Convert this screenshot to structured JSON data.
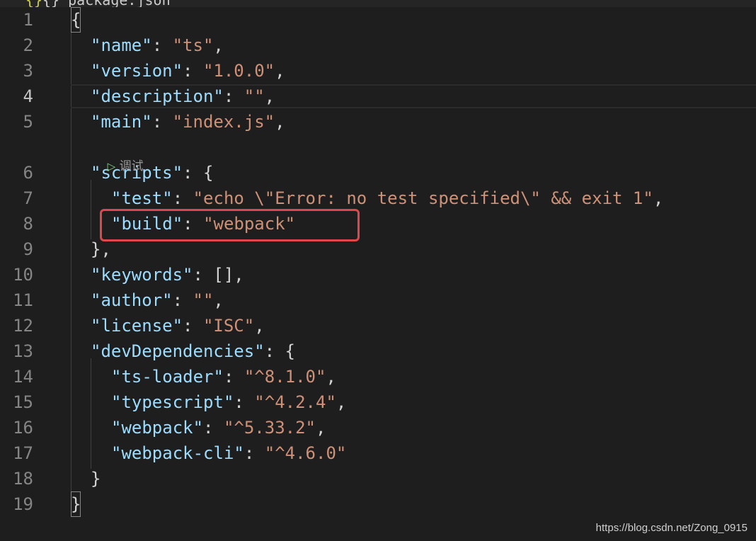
{
  "tab": {
    "icon": "json-braces-icon",
    "label": "{} package.json"
  },
  "codelens": {
    "label": "调试"
  },
  "lines": [
    {
      "n": "1",
      "tokens": [
        {
          "t": "{",
          "c": "p"
        }
      ]
    },
    {
      "n": "2",
      "tokens": [
        {
          "t": "\"name\"",
          "c": "k"
        },
        {
          "t": ": ",
          "c": "p"
        },
        {
          "t": "\"ts\"",
          "c": "s"
        },
        {
          "t": ",",
          "c": "p"
        }
      ]
    },
    {
      "n": "3",
      "tokens": [
        {
          "t": "\"version\"",
          "c": "k"
        },
        {
          "t": ": ",
          "c": "p"
        },
        {
          "t": "\"1.0.0\"",
          "c": "s"
        },
        {
          "t": ",",
          "c": "p"
        }
      ]
    },
    {
      "n": "4",
      "tokens": [
        {
          "t": "\"description\"",
          "c": "k"
        },
        {
          "t": ": ",
          "c": "p"
        },
        {
          "t": "\"\"",
          "c": "s"
        },
        {
          "t": ",",
          "c": "p"
        }
      ]
    },
    {
      "n": "5",
      "tokens": [
        {
          "t": "\"main\"",
          "c": "k"
        },
        {
          "t": ": ",
          "c": "p"
        },
        {
          "t": "\"index.js\"",
          "c": "s"
        },
        {
          "t": ",",
          "c": "p"
        }
      ]
    },
    {
      "n": "6",
      "tokens": [
        {
          "t": "\"scripts\"",
          "c": "k"
        },
        {
          "t": ": {",
          "c": "p"
        }
      ]
    },
    {
      "n": "7",
      "tokens": [
        {
          "t": "\"test\"",
          "c": "k"
        },
        {
          "t": ": ",
          "c": "p"
        },
        {
          "t": "\"echo \\\"Error: no test specified\\\" && exit 1\"",
          "c": "s"
        },
        {
          "t": ",",
          "c": "p"
        }
      ]
    },
    {
      "n": "8",
      "tokens": [
        {
          "t": "\"build\"",
          "c": "k"
        },
        {
          "t": ": ",
          "c": "p"
        },
        {
          "t": "\"webpack\"",
          "c": "s"
        }
      ]
    },
    {
      "n": "9",
      "tokens": [
        {
          "t": "},",
          "c": "p"
        }
      ]
    },
    {
      "n": "10",
      "tokens": [
        {
          "t": "\"keywords\"",
          "c": "k"
        },
        {
          "t": ": [],",
          "c": "p"
        }
      ]
    },
    {
      "n": "11",
      "tokens": [
        {
          "t": "\"author\"",
          "c": "k"
        },
        {
          "t": ": ",
          "c": "p"
        },
        {
          "t": "\"\"",
          "c": "s"
        },
        {
          "t": ",",
          "c": "p"
        }
      ]
    },
    {
      "n": "12",
      "tokens": [
        {
          "t": "\"license\"",
          "c": "k"
        },
        {
          "t": ": ",
          "c": "p"
        },
        {
          "t": "\"ISC\"",
          "c": "s"
        },
        {
          "t": ",",
          "c": "p"
        }
      ]
    },
    {
      "n": "13",
      "tokens": [
        {
          "t": "\"devDependencies\"",
          "c": "k"
        },
        {
          "t": ": {",
          "c": "p"
        }
      ]
    },
    {
      "n": "14",
      "tokens": [
        {
          "t": "\"ts-loader\"",
          "c": "k"
        },
        {
          "t": ": ",
          "c": "p"
        },
        {
          "t": "\"^8.1.0\"",
          "c": "s"
        },
        {
          "t": ",",
          "c": "p"
        }
      ]
    },
    {
      "n": "15",
      "tokens": [
        {
          "t": "\"typescript\"",
          "c": "k"
        },
        {
          "t": ": ",
          "c": "p"
        },
        {
          "t": "\"^4.2.4\"",
          "c": "s"
        },
        {
          "t": ",",
          "c": "p"
        }
      ]
    },
    {
      "n": "16",
      "tokens": [
        {
          "t": "\"webpack\"",
          "c": "k"
        },
        {
          "t": ": ",
          "c": "p"
        },
        {
          "t": "\"^5.33.2\"",
          "c": "s"
        },
        {
          "t": ",",
          "c": "p"
        }
      ]
    },
    {
      "n": "17",
      "tokens": [
        {
          "t": "\"webpack-cli\"",
          "c": "k"
        },
        {
          "t": ": ",
          "c": "p"
        },
        {
          "t": "\"^4.6.0\"",
          "c": "s"
        }
      ]
    },
    {
      "n": "18",
      "tokens": [
        {
          "t": "}",
          "c": "p"
        }
      ]
    },
    {
      "n": "19",
      "tokens": [
        {
          "t": "}",
          "c": "p"
        }
      ]
    }
  ],
  "current_line": "4",
  "watermark": "https://blog.csdn.net/Zong_0915",
  "colors": {
    "background": "#1e1e1e",
    "json_key": "#9cdcfe",
    "json_string": "#ce9178",
    "punctuation": "#d4d4d4",
    "line_number": "#858585",
    "highlight_box": "#e0464d"
  }
}
